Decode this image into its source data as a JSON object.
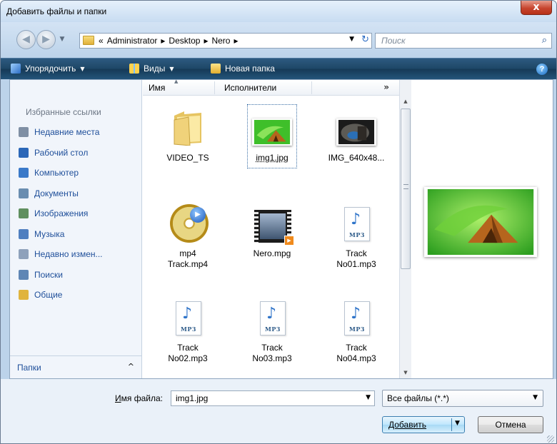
{
  "window": {
    "title": "Добавить файлы и папки",
    "close_glyph": "x"
  },
  "address": {
    "segments": [
      {
        "label": "«",
        "sep": ""
      },
      {
        "label": "Administrator",
        "sep": "▸"
      },
      {
        "label": "Desktop",
        "sep": "▸"
      },
      {
        "label": "Nero",
        "sep": "▸"
      }
    ],
    "search_placeholder": "Поиск"
  },
  "toolbar": {
    "organize": "Упорядочить",
    "views": "Виды",
    "new_folder": "Новая папка"
  },
  "nav": {
    "title": "Избранные ссылки",
    "items": [
      {
        "label": "Недавние места",
        "color": "#7f8fa4"
      },
      {
        "label": "Рабочий стол",
        "color": "#2b67b8"
      },
      {
        "label": "Компьютер",
        "color": "#3a79c9"
      },
      {
        "label": "Документы",
        "color": "#6a8db0"
      },
      {
        "label": "Изображения",
        "color": "#5f8f5f"
      },
      {
        "label": "Музыка",
        "color": "#4f7fc0"
      },
      {
        "label": "Недавно измен...",
        "color": "#8ea1bb"
      },
      {
        "label": "Поиски",
        "color": "#5f86b5"
      },
      {
        "label": "Общие",
        "color": "#e0b43e"
      }
    ],
    "folders_label": "Папки"
  },
  "columns": {
    "name": "Имя",
    "artist": "Исполнители",
    "more": "»"
  },
  "files": [
    {
      "label": "VIDEO_TS",
      "kind": "folder"
    },
    {
      "label": "img1.jpg",
      "kind": "image-green",
      "selected": true
    },
    {
      "label": "IMG_640x48...",
      "kind": "image-cave"
    },
    {
      "label": "mp4\nTrack.mp4",
      "kind": "disc"
    },
    {
      "label": "Nero.mpg",
      "kind": "film"
    },
    {
      "label": "Track\nNo01.mp3",
      "kind": "mp3"
    },
    {
      "label": "Track\nNo02.mp3",
      "kind": "mp3"
    },
    {
      "label": "Track\nNo03.mp3",
      "kind": "mp3"
    },
    {
      "label": "Track\nNo04.mp3",
      "kind": "mp3"
    }
  ],
  "bottom": {
    "filename_label_prefix": "И",
    "filename_label_rest": "мя файла:",
    "filename_value": "img1.jpg",
    "filetype_value": "Все файлы (*.*)",
    "open_button": "Добавить",
    "cancel_button": "Отмена"
  }
}
